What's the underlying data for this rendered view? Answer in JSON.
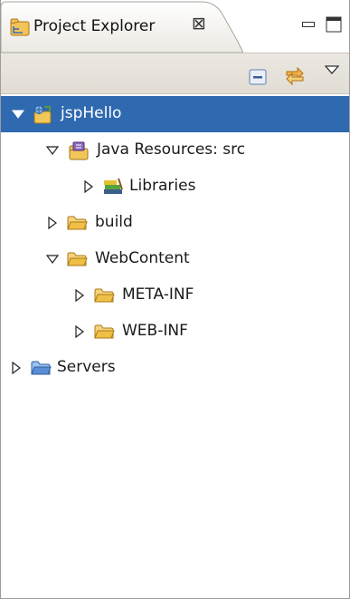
{
  "view": {
    "title": "Project Explorer",
    "close_glyph": "⊠",
    "minimize_icon": "minimize-icon",
    "maximize_icon": "maximize-icon"
  },
  "toolbar": {
    "collapse_all_icon": "collapse-all-icon",
    "link_with_editor_icon": "link-with-editor-icon",
    "view_menu_icon": "view-menu-icon"
  },
  "tree": {
    "items": [
      {
        "label": "jspHello",
        "expanded": true,
        "selected": true,
        "icon": "web-project-icon"
      },
      {
        "label": "Java Resources: src",
        "expanded": true,
        "icon": "java-resources-icon"
      },
      {
        "label": "Libraries",
        "expanded": false,
        "icon": "libraries-icon"
      },
      {
        "label": "build",
        "expanded": false,
        "icon": "folder-icon"
      },
      {
        "label": "WebContent",
        "expanded": true,
        "icon": "folder-icon"
      },
      {
        "label": "META-INF",
        "expanded": false,
        "icon": "folder-icon"
      },
      {
        "label": "WEB-INF",
        "expanded": false,
        "icon": "folder-icon"
      },
      {
        "label": "Servers",
        "expanded": false,
        "icon": "servers-folder-icon"
      }
    ]
  },
  "colors": {
    "selection": "#2f69b0",
    "toolbar": "#e6e3dc",
    "folder": "#f0c24a",
    "servers_folder": "#5a8fd8"
  }
}
